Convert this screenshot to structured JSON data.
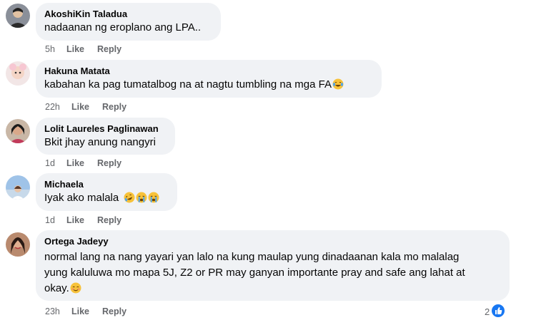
{
  "comments": [
    {
      "author": "AkoshiKin Taladua",
      "text": "nadaanan ng eroplano ang LPA..",
      "time": "5h",
      "like": "Like",
      "reply": "Reply"
    },
    {
      "author": "Hakuna Matata",
      "text": "kabahan ka pag tumatalbog na at nagtu tumbling na mga FA",
      "time": "22h",
      "like": "Like",
      "reply": "Reply",
      "emoji": [
        "laughing-tears"
      ]
    },
    {
      "author": "Lolit Laureles Paglinawan",
      "text": "Bkit jhay anung nangyri",
      "time": "1d",
      "like": "Like",
      "reply": "Reply"
    },
    {
      "author": "Michaela",
      "text": "Iyak ako malala",
      "time": "1d",
      "like": "Like",
      "reply": "Reply",
      "emoji": [
        "rolling-laughing",
        "crying",
        "crying"
      ]
    },
    {
      "author": "Ortega Jadeyy",
      "text_lines": [
        "normal lang na nang yayari yan lalo na kung maulap yung dinadaanan kala mo malalag",
        "yung kaluluwa mo mapa 5J, Z2 or PR may ganyan importante pray and safe ang lahat at",
        "okay."
      ],
      "time": "23h",
      "like": "Like",
      "reply": "Reply",
      "emoji": [
        "smiling-blush"
      ],
      "reaction_count": "2",
      "reaction_icon": "thumbs-up-icon"
    }
  ],
  "colors": {
    "bubble": "#f0f2f5",
    "meta": "#65676b",
    "like_blue": "#1877f2"
  }
}
